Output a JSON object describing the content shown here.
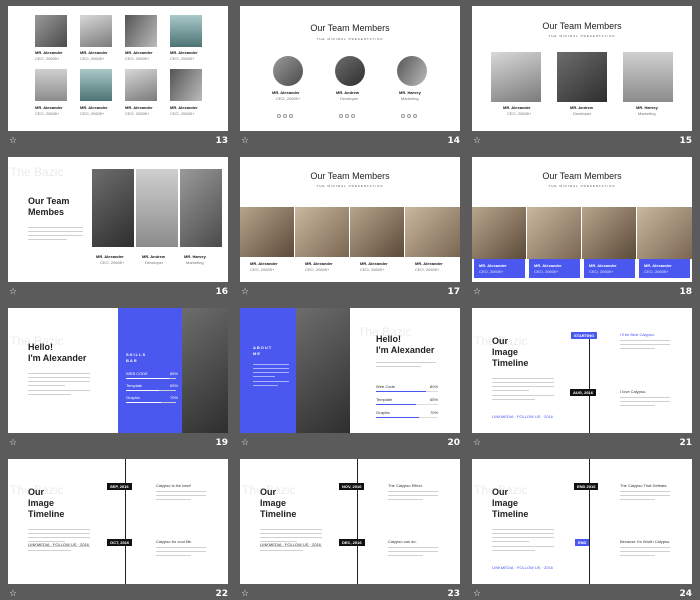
{
  "slides": [
    {
      "number": "13",
      "people": [
        {
          "name": "MR. Alexander",
          "role": "CEO, 20605+"
        },
        {
          "name": "MR. Alexander",
          "role": "CEO, 20605+"
        },
        {
          "name": "MR. Alexander",
          "role": "CEO, 20605+"
        },
        {
          "name": "MR. Alexander",
          "role": "CEO, 20605+"
        },
        {
          "name": "MR. Alexander",
          "role": "CEO, 20605+"
        },
        {
          "name": "MR. Alexander",
          "role": "CEO, 20605+"
        },
        {
          "name": "MR. Alexander",
          "role": "CEO, 20605+"
        },
        {
          "name": "MR. Alexander",
          "role": "CEO, 20605+"
        }
      ]
    },
    {
      "number": "14",
      "title": "Our Team Members",
      "subtitle": "THE MINIMAL PRESENTATION",
      "people": [
        {
          "name": "MR. Alexander",
          "role": "CEO, 20605+"
        },
        {
          "name": "MR. Andrew",
          "role": "Developer"
        },
        {
          "name": "MR. Harvey",
          "role": "Marketing"
        }
      ]
    },
    {
      "number": "15",
      "title": "Our Team Members",
      "subtitle": "THE MINIMAL PRESENTATION",
      "people": [
        {
          "name": "MR. Alexander",
          "role": "CEO, 20605+"
        },
        {
          "name": "MR. Andrew",
          "role": "Developer"
        },
        {
          "name": "MR. Harvey",
          "role": "Marketing"
        }
      ]
    },
    {
      "number": "16",
      "watermark": "The Bazic",
      "title_line1": "Our Team",
      "title_line2": "Membes",
      "people": [
        {
          "name": "MR. Alexander",
          "role": "CEO, 20605+"
        },
        {
          "name": "MR. Andrew",
          "role": "Developer"
        },
        {
          "name": "MR. Harvey",
          "role": "Marketing"
        }
      ]
    },
    {
      "number": "17",
      "title": "Our Team Members",
      "subtitle": "THE MINIMAL PRESENTATION",
      "people": [
        {
          "name": "MR. Alexander",
          "role": "CEO, 20605+"
        },
        {
          "name": "MR. Alexander",
          "role": "CEO, 20605+"
        },
        {
          "name": "MR. Alexander",
          "role": "CEO, 20605+"
        },
        {
          "name": "MR. Alexander",
          "role": "CEO, 20605+"
        }
      ]
    },
    {
      "number": "18",
      "title": "Our Team Members",
      "subtitle": "THE MINIMAL PRESENTATION",
      "people": [
        {
          "name": "MR. Alexander",
          "role": "CEO, 20605+"
        },
        {
          "name": "MR. Alexander",
          "role": "CEO, 20605+"
        },
        {
          "name": "MR. Alexander",
          "role": "CEO, 20605+"
        },
        {
          "name": "MR. Alexander",
          "role": "CEO, 20605+"
        }
      ]
    },
    {
      "number": "19",
      "watermark": "The Bazic",
      "title_line1": "Hello!",
      "title_line2": "I'm Alexander",
      "skills_line1": "SKILLS",
      "skills_line2": "BAR",
      "skills": [
        {
          "label": "WEB CODE",
          "pct": "85%",
          "value": 0.85
        },
        {
          "label": "Template",
          "pct": "65%",
          "value": 0.65
        },
        {
          "label": "Graphic",
          "pct": "70%",
          "value": 0.7
        }
      ]
    },
    {
      "number": "20",
      "watermark": "The Bazic",
      "about_line1": "ABOUT",
      "about_line2": "ME",
      "title_line1": "Hello!",
      "title_line2": "I'm Alexander",
      "skills": [
        {
          "label": "Web Code",
          "pct": "80%",
          "value": 0.8
        },
        {
          "label": "Template",
          "pct": "65%",
          "value": 0.65
        },
        {
          "label": "Graphic",
          "pct": "70%",
          "value": 0.7
        }
      ]
    },
    {
      "number": "21",
      "watermark": "The Bazic",
      "title_line1": "Our",
      "title_line2": "Image",
      "title_line3": "Timeline",
      "tag1": "STARTING",
      "tag2": "AUG, 2016",
      "event1": "I'll be Best Calypso.",
      "event2": "I love Calypso.",
      "link": "LINKMEDIA · FOLLOW US · 2016"
    },
    {
      "number": "22",
      "watermark": "The Bazic",
      "title_line1": "Our",
      "title_line2": "Image",
      "title_line3": "Timeline",
      "tag1": "SEP, 2016",
      "tag2": "OCT, 2016",
      "event1": "Calypso is the best!",
      "event2": "Calypso for cool life.",
      "link": "LINKMEDIA · FOLLOW US · 2016"
    },
    {
      "number": "23",
      "watermark": "The Bazic",
      "title_line1": "Our",
      "title_line2": "Image",
      "title_line3": "Timeline",
      "tag1": "NOV, 2016",
      "tag2": "DEC, 2016",
      "event1": "The Calypso Effect.",
      "event2": "Calypso can do.",
      "link": "LINKMEDIA · FOLLOW US · 2016"
    },
    {
      "number": "24",
      "watermark": "The Bazic",
      "title_line1": "Our",
      "title_line2": "Image",
      "title_line3": "Timeline",
      "tag1": "END 2016",
      "tag2": "END",
      "event1": "The Calypso That Defeats.",
      "event2": "Because I'm Worth Calypso.",
      "link": "LINKMEDIA · FOLLOW US · 2016"
    }
  ],
  "colors": {
    "accent": "#4a58f0",
    "background": "#5b5b5b",
    "slide": "#ffffff"
  }
}
